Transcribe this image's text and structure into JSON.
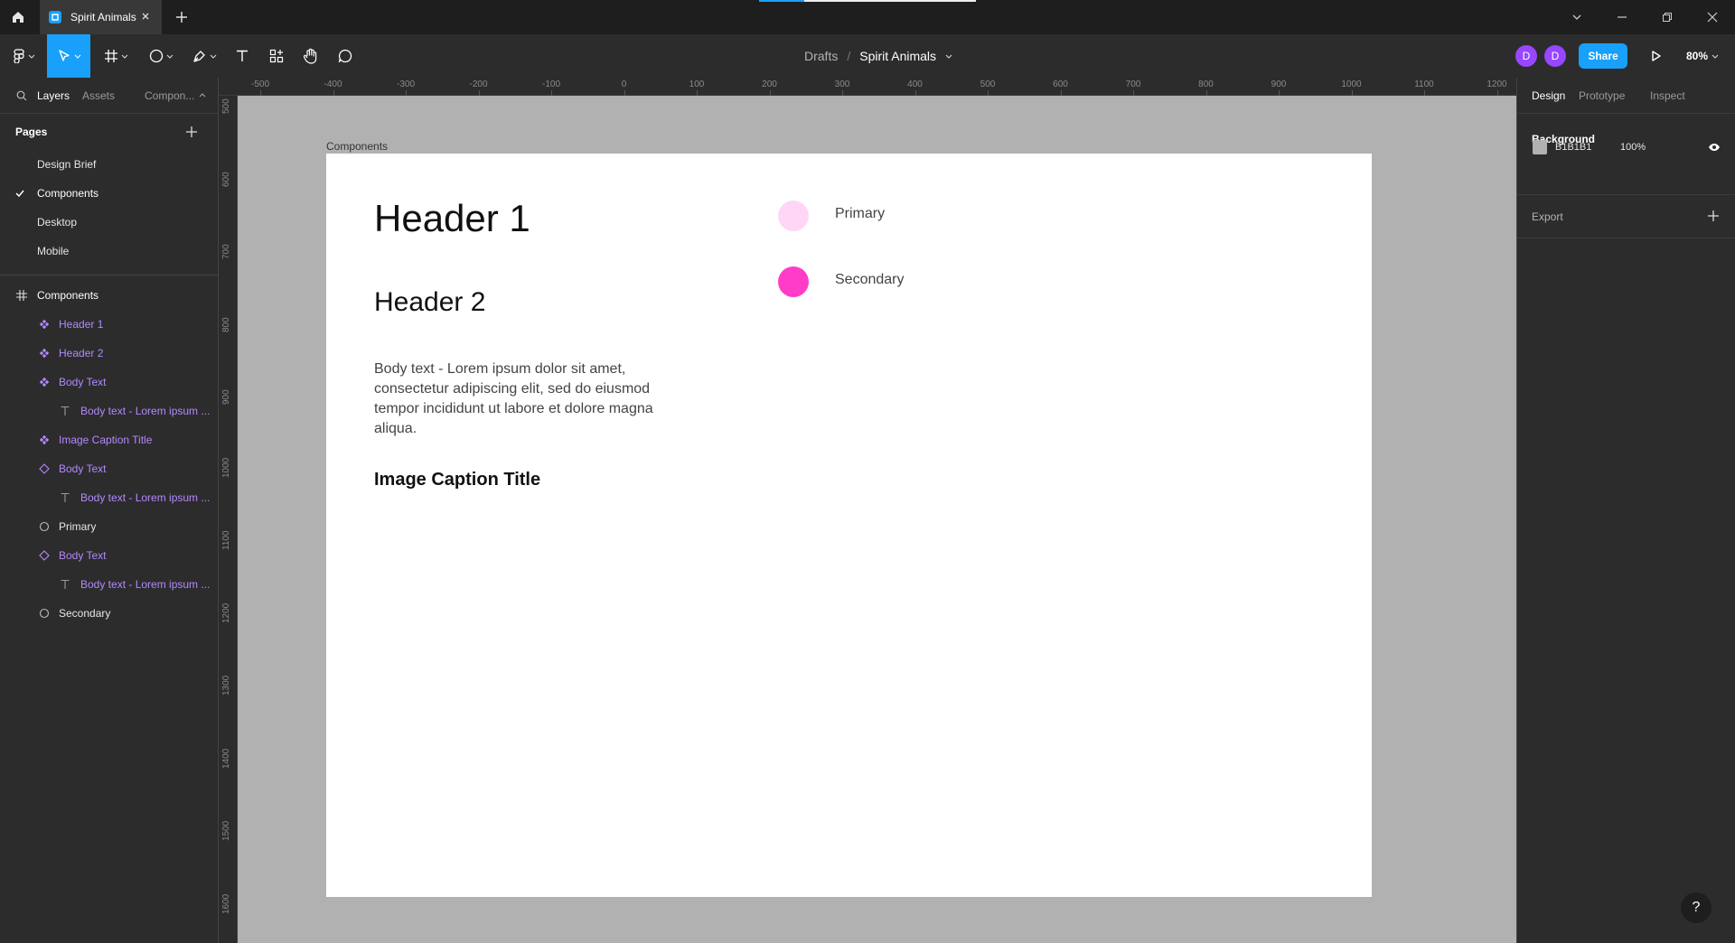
{
  "titlebar": {
    "tab_title": "Spirit Animals",
    "progress": 0.21
  },
  "toolbar": {
    "breadcrumb_parent": "Drafts",
    "breadcrumb_separator": "/",
    "file_name": "Spirit Animals",
    "avatars": [
      "D",
      "D"
    ],
    "share_label": "Share",
    "zoom": "80%"
  },
  "left_panel": {
    "tabs": [
      "Layers",
      "Assets",
      "Compon..."
    ],
    "pages_title": "Pages",
    "pages": [
      "Design Brief",
      "Components",
      "Desktop",
      "Mobile"
    ],
    "active_page": "Components",
    "frame_name": "Components",
    "layers": [
      {
        "label": "Header 1",
        "icon": "component-icon"
      },
      {
        "label": "Header 2",
        "icon": "component-icon"
      },
      {
        "label": "Body Text",
        "icon": "component-icon"
      },
      {
        "label": "Body text - Lorem ipsum ...",
        "icon": "text-icon"
      },
      {
        "label": "Image Caption Title",
        "icon": "component-icon"
      },
      {
        "label": "Body Text",
        "icon": "instance-icon"
      },
      {
        "label": "Body text - Lorem ipsum ...",
        "icon": "text-icon"
      },
      {
        "label": "Primary",
        "icon": "ellipse-icon"
      },
      {
        "label": "Body Text",
        "icon": "instance-icon"
      },
      {
        "label": "Body text - Lorem ipsum ...",
        "icon": "text-icon"
      },
      {
        "label": "Secondary",
        "icon": "ellipse-icon"
      }
    ]
  },
  "rulers": {
    "top": [
      "-500",
      "-400",
      "-300",
      "-200",
      "-100",
      "0",
      "100",
      "200",
      "300",
      "400",
      "500",
      "600",
      "700",
      "800",
      "900",
      "1000",
      "1100",
      "1200"
    ],
    "left": [
      "500",
      "600",
      "700",
      "800",
      "900",
      "1000",
      "1100",
      "1200",
      "1300",
      "1400",
      "1500",
      "1600"
    ]
  },
  "canvas": {
    "background": "#B1B1B1",
    "frame_label": "Components",
    "header1": "Header 1",
    "header2": "Header 2",
    "body_text": "Body text - Lorem ipsum dolor sit amet, consectetur adipiscing elit, sed do eiusmod tempor incididunt ut labore et dolore magna aliqua.",
    "caption_title": "Image Caption Title",
    "swatches": [
      {
        "label": "Primary",
        "color": "#FFD6F5"
      },
      {
        "label": "Secondary",
        "color": "#FF3CC8"
      }
    ]
  },
  "right_panel": {
    "tabs": [
      "Design",
      "Prototype",
      "Inspect"
    ],
    "background_title": "Background",
    "background_hex": "B1B1B1",
    "background_opacity": "100%",
    "export_title": "Export"
  },
  "help_label": "?",
  "colors": {
    "accent": "#18A0FB",
    "component_purple": "#B388FF",
    "avatar": "#9747FF"
  }
}
